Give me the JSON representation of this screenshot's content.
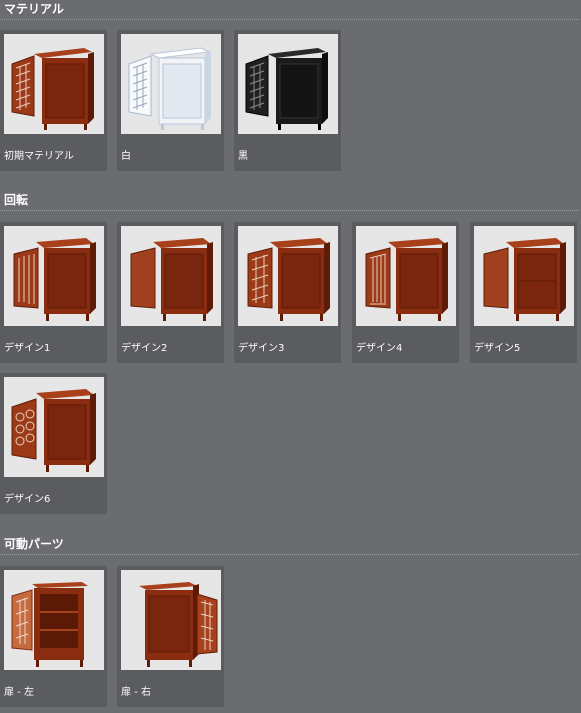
{
  "colors": {
    "background": "#6b6c6f",
    "tile": "#5b5c5f",
    "thumb_bg": "#e6e6e6",
    "wood": "#8a2c10",
    "white_finish": "#f2f4f7",
    "black_finish": "#1a1a1a"
  },
  "sections": [
    {
      "title": "マテリアル",
      "items": [
        {
          "label": "初期マテリアル",
          "icon": "cabinet-open-left-door-icon",
          "finish": "wood"
        },
        {
          "label": "白",
          "icon": "cabinet-open-left-door-icon",
          "finish": "white"
        },
        {
          "label": "黒",
          "icon": "cabinet-open-left-door-icon",
          "finish": "black"
        }
      ]
    },
    {
      "title": "回転",
      "items": [
        {
          "label": "デザイン1",
          "icon": "cabinet-design-icon",
          "finish": "wood"
        },
        {
          "label": "デザイン2",
          "icon": "cabinet-design-icon",
          "finish": "wood"
        },
        {
          "label": "デザイン3",
          "icon": "cabinet-design-icon",
          "finish": "wood"
        },
        {
          "label": "デザイン4",
          "icon": "cabinet-design-icon",
          "finish": "wood"
        },
        {
          "label": "デザイン5",
          "icon": "cabinet-design-icon",
          "finish": "wood"
        },
        {
          "label": "デザイン6",
          "icon": "cabinet-design-icon",
          "finish": "wood"
        }
      ]
    },
    {
      "title": "可動パーツ",
      "items": [
        {
          "label": "扉 - 左",
          "icon": "cabinet-left-door-open-icon",
          "finish": "wood"
        },
        {
          "label": "扉 - 右",
          "icon": "cabinet-right-door-open-icon",
          "finish": "wood"
        }
      ]
    }
  ]
}
